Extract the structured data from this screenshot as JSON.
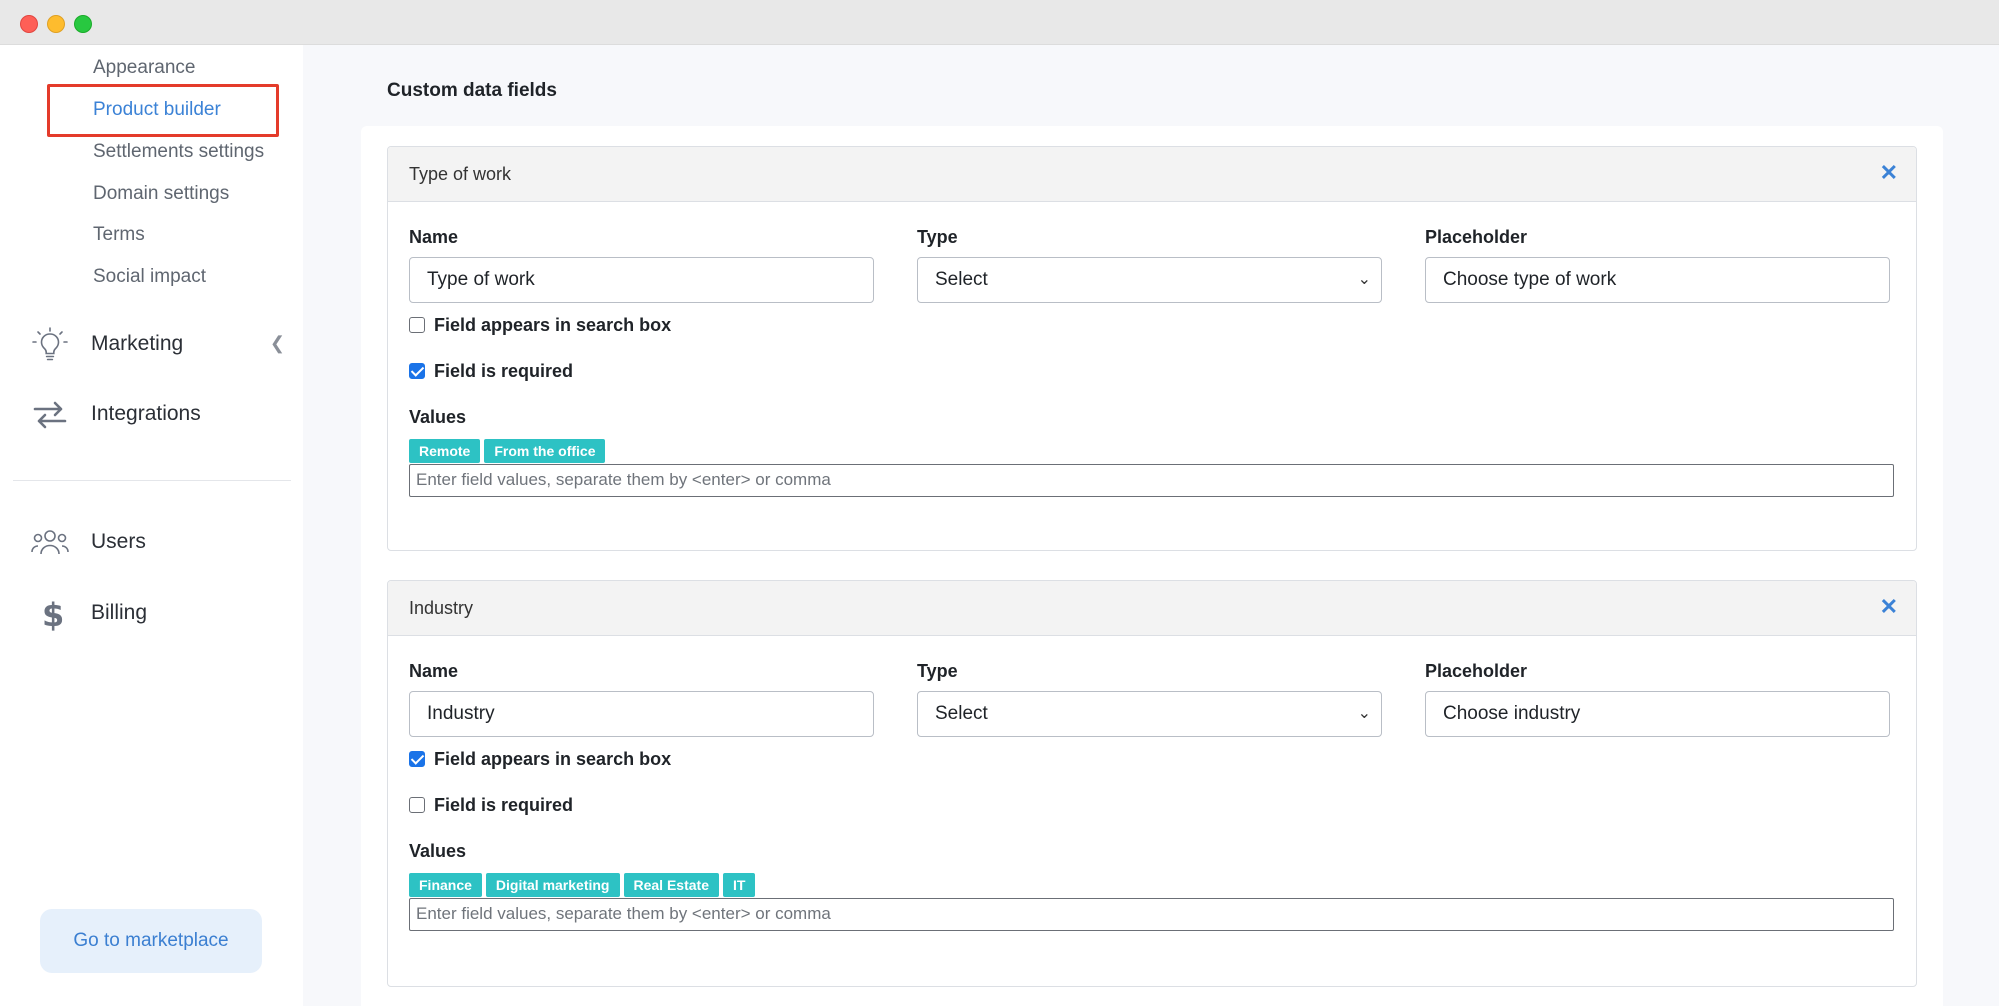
{
  "sidebar": {
    "sub_items": [
      {
        "label": "Appearance",
        "active": false
      },
      {
        "label": "Product builder",
        "active": true
      },
      {
        "label": "Settlements settings",
        "active": false
      },
      {
        "label": "Domain settings",
        "active": false
      },
      {
        "label": "Terms",
        "active": false
      },
      {
        "label": "Social impact",
        "active": false
      }
    ],
    "nav": [
      {
        "label": "Marketing",
        "icon": "lightbulb-icon"
      },
      {
        "label": "Integrations",
        "icon": "transfer-arrows-icon"
      },
      {
        "label": "Users",
        "icon": "users-icon"
      },
      {
        "label": "Billing",
        "icon": "dollar-icon"
      }
    ],
    "marketplace_button": "Go to marketplace"
  },
  "main": {
    "title": "Custom data fields",
    "fields": [
      {
        "header": "Type of work",
        "name_label": "Name",
        "type_label": "Type",
        "placeholder_label": "Placeholder",
        "name_value": "Type of work",
        "type_value": "Select",
        "placeholder_value": "Choose type of work",
        "search_box_label": "Field appears in search box",
        "search_box_checked": false,
        "required_label": "Field is required",
        "required_checked": true,
        "values_label": "Values",
        "values": [
          "Remote",
          "From the office"
        ],
        "values_placeholder": "Enter field values, separate them by <enter> or comma"
      },
      {
        "header": "Industry",
        "name_label": "Name",
        "type_label": "Type",
        "placeholder_label": "Placeholder",
        "name_value": "Industry",
        "type_value": "Select",
        "placeholder_value": "Choose industry",
        "search_box_label": "Field appears in search box",
        "search_box_checked": true,
        "required_label": "Field is required",
        "required_checked": false,
        "values_label": "Values",
        "values": [
          "Finance",
          "Digital marketing",
          "Real Estate",
          "IT"
        ],
        "values_placeholder": "Enter field values, separate them by <enter> or comma"
      }
    ]
  },
  "colors": {
    "accent": "#3b82d6",
    "highlight": "#e43b2a",
    "tag": "#2dc2c4",
    "checkbox": "#1a73e8"
  }
}
